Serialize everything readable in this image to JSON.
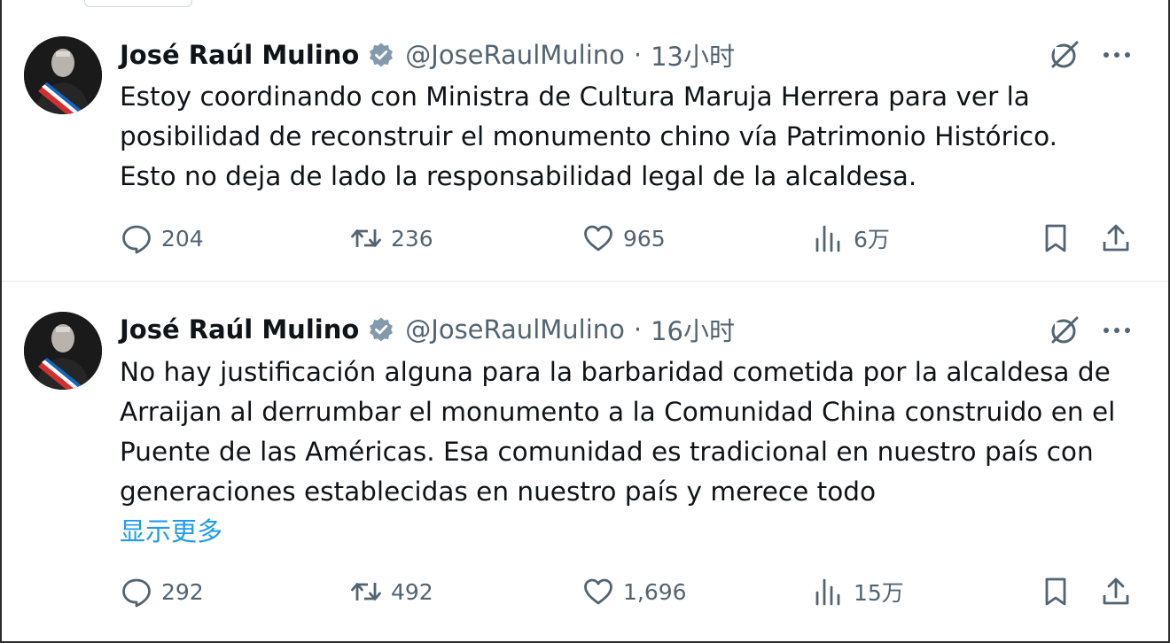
{
  "tweets": [
    {
      "author_name": "José Raúl Mulino",
      "handle": "@JoseRaulMulino",
      "separator": "·",
      "time": "13小时",
      "text_lines": [
        "Estoy coordinando con Ministra de Cultura Maruja Herrera para ver la",
        "posibilidad de reconstruir el monumento chino vía Patrimonio Histórico.",
        "Esto no deja de lado la responsabilidad legal de la alcaldesa."
      ],
      "show_more": "",
      "replies": "204",
      "reposts": "236",
      "likes": "965",
      "views": "6万"
    },
    {
      "author_name": "José Raúl Mulino",
      "handle": "@JoseRaulMulino",
      "separator": "·",
      "time": "16小时",
      "text_lines": [
        "No hay justificación alguna para la barbaridad cometida por la alcaldesa de",
        "Arraijan al derrumbar el monumento a la Comunidad China construido en el",
        "Puente de las Américas. Esa comunidad es tradicional en nuestro país con",
        "generaciones establecidas en nuestro país y merece todo"
      ],
      "show_more": "显示更多",
      "replies": "292",
      "reposts": "492",
      "likes": "1,696",
      "views": "15万"
    }
  ],
  "icons": {
    "verified": "verified-badge-icon",
    "grok": "grok-icon",
    "more": "more-dots-icon",
    "reply": "reply-bubble-icon",
    "repost": "repost-arrows-icon",
    "like": "heart-icon",
    "views": "views-bars-icon",
    "bookmark": "bookmark-icon",
    "share": "share-upload-icon"
  },
  "colors": {
    "text": "#0f1419",
    "secondary": "#536471",
    "link": "#1d9bf0",
    "verified": "#829aab"
  }
}
